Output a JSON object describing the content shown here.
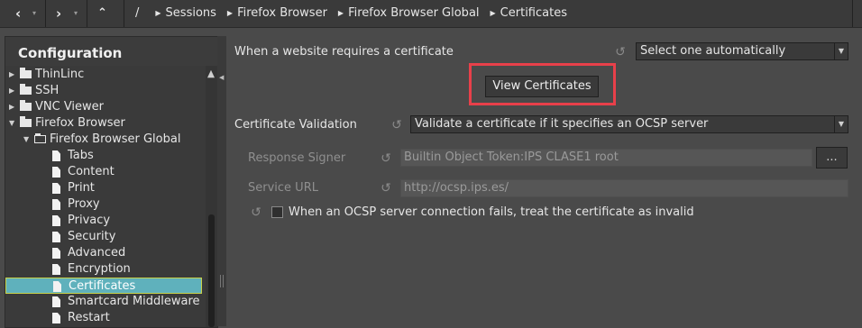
{
  "nav": {
    "back_icon": "back-chevron-icon",
    "forward_icon": "forward-chevron-icon",
    "up_icon": "up-chevron-icon",
    "root_sep": "/",
    "breadcrumbs": [
      "Sessions",
      "Firefox Browser",
      "Firefox Browser Global",
      "Certificates"
    ]
  },
  "sidebar": {
    "title": "Configuration",
    "items": [
      {
        "label": "ThinLinc"
      },
      {
        "label": "SSH"
      },
      {
        "label": "VNC Viewer"
      },
      {
        "label": "Firefox Browser"
      },
      {
        "label": "Firefox Browser Global"
      },
      {
        "label": "Tabs"
      },
      {
        "label": "Content"
      },
      {
        "label": "Print"
      },
      {
        "label": "Proxy"
      },
      {
        "label": "Privacy"
      },
      {
        "label": "Security"
      },
      {
        "label": "Advanced"
      },
      {
        "label": "Encryption"
      },
      {
        "label": "Certificates"
      },
      {
        "label": "Smartcard Middleware"
      },
      {
        "label": "Restart"
      }
    ],
    "selected": "Certificates"
  },
  "main": {
    "cert_request": {
      "label": "When a website requires a certificate",
      "value": "Select one automatically"
    },
    "view_certificates_label": "View Certificates",
    "validation": {
      "label": "Certificate Validation",
      "value": "Validate a certificate if it specifies an OCSP server"
    },
    "response_signer": {
      "label": "Response Signer",
      "value": "Builtin Object Token:IPS CLASE1 root",
      "browse_label": "..."
    },
    "service_url": {
      "label": "Service URL",
      "value": "http://ocsp.ips.es/"
    },
    "ocsp_fail": {
      "label": "When an OCSP server connection fails, treat the certificate as invalid",
      "checked": false
    }
  },
  "colors": {
    "selection": "#5fb1bc",
    "selection_border": "#c8d24a",
    "highlight_box": "#e8404a"
  }
}
